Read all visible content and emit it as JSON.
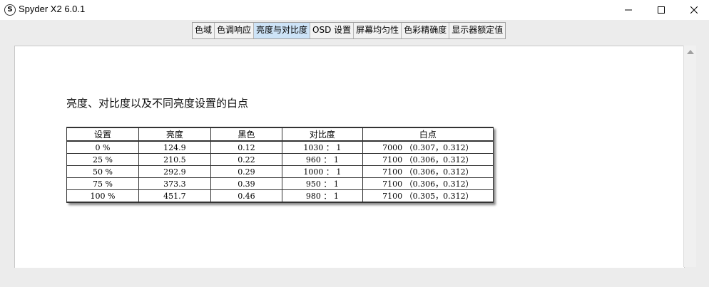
{
  "window": {
    "title": "Spyder X2 6.0.1",
    "icon": "spyder-logo-icon"
  },
  "tabs": [
    {
      "label": "色域",
      "active": false
    },
    {
      "label": "色调响应",
      "active": false
    },
    {
      "label": "亮度与对比度",
      "active": true
    },
    {
      "label": "OSD 设置",
      "active": false
    },
    {
      "label": "屏幕均匀性",
      "active": false
    },
    {
      "label": "色彩精确度",
      "active": false
    },
    {
      "label": "显示器额定值",
      "active": false
    }
  ],
  "zoom": {
    "buttons": [
      "zoom-in-icon",
      "zoom-out-icon",
      "zoom-fit-icon"
    ]
  },
  "report": {
    "title": "亮度、对比度以及不同亮度设置的白点",
    "columns": [
      "设置",
      "亮度",
      "黑色",
      "对比度",
      "白点"
    ],
    "rows": [
      [
        "0 %",
        "124.9",
        "0.12",
        "1030 ： 1",
        "7000 （0.307，0.312）"
      ],
      [
        "25 %",
        "210.5",
        "0.22",
        "960 ： 1",
        "7100 （0.306，0.312）"
      ],
      [
        "50 %",
        "292.9",
        "0.29",
        "1000 ： 1",
        "7100 （0.306，0.312）"
      ],
      [
        "75 %",
        "373.3",
        "0.39",
        "950 ： 1",
        "7100 （0.306，0.312）"
      ],
      [
        "100 %",
        "451.7",
        "0.46",
        "980 ： 1",
        "7100 （0.305，0.312）"
      ]
    ]
  },
  "colors": {
    "active_tab": "#cde3f7",
    "work_area": "#ececec",
    "panel": "#ffffff"
  }
}
